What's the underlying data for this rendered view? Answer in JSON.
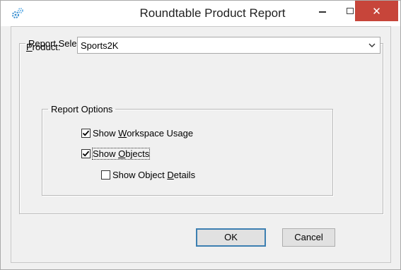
{
  "window": {
    "title": "Roundtable Product Report",
    "close_glyph": "✕",
    "accent_close": "#c7453a"
  },
  "selections": {
    "group_label": "Report Selections",
    "product_label_prefix": "P",
    "product_label_rest": "roduct:",
    "product_value": "Sports2K"
  },
  "options": {
    "group_label": "Report Options",
    "items": [
      {
        "pre": "Show ",
        "accel": "W",
        "post": "orkspace Usage",
        "checked": true
      },
      {
        "pre": "Show ",
        "accel": "O",
        "post": "bjects",
        "checked": true
      },
      {
        "pre": "Show Object ",
        "accel": "D",
        "post": "etails",
        "checked": false
      }
    ]
  },
  "buttons": {
    "ok": "OK",
    "cancel": "Cancel"
  },
  "icons": {
    "app": "gear-app-icon",
    "dropdown": "chevron-down-icon",
    "check": "check-icon"
  }
}
